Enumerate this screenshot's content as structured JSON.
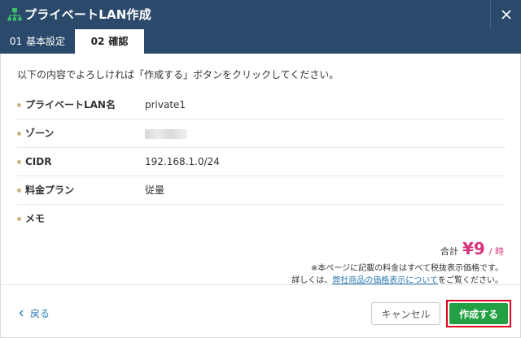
{
  "dialog": {
    "title": "プライベートLAN作成",
    "icon": "network-icon"
  },
  "tabs": [
    {
      "num": "01",
      "label": "基本設定",
      "active": false
    },
    {
      "num": "02",
      "label": "確認",
      "active": true
    }
  ],
  "intro": "以下の内容でよろしければ「作成する」ボタンをクリックしてください。",
  "fields": [
    {
      "label": "プライベートLAN名",
      "value": "private1"
    },
    {
      "label": "ゾーン",
      "value": ""
    },
    {
      "label": "CIDR",
      "value": "192.168.1.0/24"
    },
    {
      "label": "料金プラン",
      "value": "従量"
    },
    {
      "label": "メモ",
      "value": ""
    }
  ],
  "price": {
    "label": "合計",
    "amount": "¥9",
    "unit": "/ 時"
  },
  "notes": {
    "line1": "※本ページに記載の料金はすべて税抜表示価格です。",
    "line2_prefix": "詳しくは、",
    "line2_link": "弊社商品の価格表示について",
    "line2_suffix": "をご覧ください。"
  },
  "footer": {
    "back_label": "戻る",
    "cancel_label": "キャンセル",
    "create_label": "作成する"
  },
  "colors": {
    "header_bg": "#2b4a6b",
    "accent_price": "#d9347e",
    "primary_button": "#22a043",
    "highlight_border": "#e1001e",
    "link": "#2a7ab0"
  }
}
